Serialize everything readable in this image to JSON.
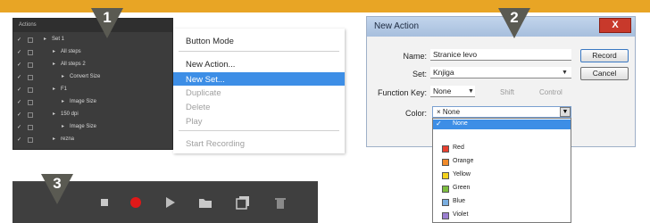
{
  "steps": [
    "1",
    "2",
    "3"
  ],
  "actions_panel": {
    "title": "Actions",
    "rows": [
      {
        "label": "Set 1",
        "indent": 0
      },
      {
        "label": "All steps",
        "indent": 1
      },
      {
        "label": "All steps 2",
        "indent": 1
      },
      {
        "label": "Convert Size",
        "indent": 2
      },
      {
        "label": "F1",
        "indent": 1
      },
      {
        "label": "Image Size",
        "indent": 2
      },
      {
        "label": "150 dpi",
        "indent": 1
      },
      {
        "label": "Image Size",
        "indent": 2
      },
      {
        "label": "rezna",
        "indent": 1
      }
    ]
  },
  "menu": {
    "items": [
      {
        "label": "Button Mode",
        "state": "normal"
      },
      {
        "label": "New Action...",
        "state": "normal"
      },
      {
        "label": "New Set...",
        "state": "selected"
      },
      {
        "label": "Duplicate",
        "state": "disabled"
      },
      {
        "label": "Delete",
        "state": "disabled"
      },
      {
        "label": "Play",
        "state": "disabled"
      },
      {
        "label": "Start Recording",
        "state": "disabled"
      }
    ]
  },
  "dialog": {
    "title": "New Action",
    "close_label": "X",
    "name_label": "Name:",
    "name_value": "Stranice levo",
    "set_label": "Set:",
    "set_value": "Knjiga",
    "fkey_label": "Function Key:",
    "fkey_value": "None",
    "shift_label": "Shift",
    "control_label": "Control",
    "color_label": "Color:",
    "color_value": "None",
    "record_label": "Record",
    "cancel_label": "Cancel",
    "color_options": [
      {
        "label": "None",
        "color": "#ffffff",
        "selected": true
      },
      {
        "label": "Red",
        "color": "#e8402f",
        "selected": false
      },
      {
        "label": "Orange",
        "color": "#f08a2a",
        "selected": false
      },
      {
        "label": "Yellow",
        "color": "#f4d21c",
        "selected": false
      },
      {
        "label": "Green",
        "color": "#7dbd3f",
        "selected": false
      },
      {
        "label": "Blue",
        "color": "#7aaee0",
        "selected": false
      },
      {
        "label": "Violet",
        "color": "#9b7fd0",
        "selected": false
      }
    ]
  },
  "toolbar": {
    "buttons": [
      "stop-icon",
      "record-icon",
      "play-icon",
      "new-set-icon",
      "new-action-icon",
      "delete-icon"
    ]
  },
  "colors": {
    "accent_band": "#e8a525",
    "badge": "#5a5a52",
    "selection": "#3d8ee6",
    "record": "#e01818"
  }
}
